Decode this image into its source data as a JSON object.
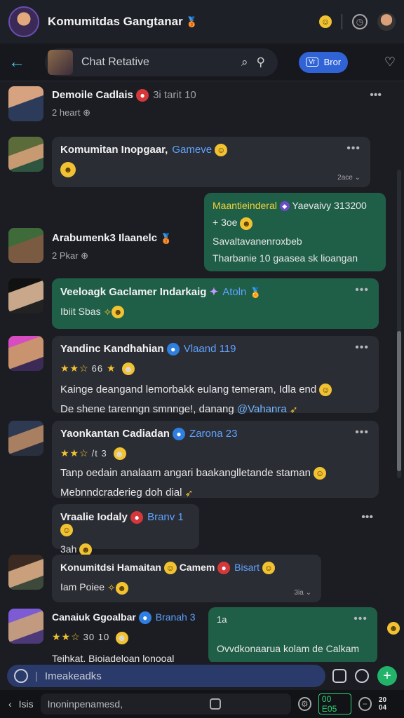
{
  "header": {
    "title": "Komumitdas Gangtanar",
    "title_emoji": "🥉",
    "right_icons": [
      "smiley-icon",
      "clock-icon",
      "profile-avatar"
    ]
  },
  "nav": {
    "search_label": "Chat Retative",
    "bot_icon_text": "Vr",
    "bot_label": "Bror"
  },
  "messages": [
    {
      "name": "Demoile Cadlais",
      "tag": "3i tarit 10",
      "sub": "2 heart ⊕"
    },
    {
      "name": "Komumitan Inopgaar,",
      "tag": "Gameve",
      "time": "2ace"
    },
    {
      "name": "Maantieinderal",
      "tag": "Yaevaivy 313200",
      "line1": "+ 3oe",
      "line2": "Savaltavanenroxbeb",
      "line3": "Tharbanie 10 gaasea sk lioangan"
    },
    {
      "name": "Arabumenk3 Ilaanelc",
      "sub": "2 Pkar ⊕"
    },
    {
      "name": "Veeloagk Gaclamer Indarkaig",
      "tag": "Atoln",
      "line1": "Ibiit Sbas"
    },
    {
      "name": "Yandinc Kandhahian",
      "tag": "Vlaand 119",
      "stars_text": "66",
      "line1": "Kainge deangand lemorbakk eulang temeram, Idla end",
      "line2a": "De shene tarenngn smnnge!, danang",
      "line2b": "@Vahanra"
    },
    {
      "name": "Yaonkantan Cadiadan",
      "tag": "Zarona 23",
      "stars_text": "/t 3",
      "line1": "Tanp oedain analaam angari baakanglletande staman",
      "line2": "Mebnndcraderieg doh dial"
    },
    {
      "name": "Vraalie Iodaly",
      "tag": "Branv 1",
      "line1": "3ah"
    },
    {
      "name": "Konumitdsi Hamaitan",
      "tag1": "Camem",
      "tag2": "Bisart",
      "line1": "Iam Poiee",
      "time": "3ia"
    },
    {
      "name": "Canaiuk Ggoalbar",
      "tag": "Branah 3",
      "stars_text": "30 10",
      "line1": "Teihkat. Bioiadeloan lonooal",
      "reply_time": "1a",
      "reply_text": "Ovvdkonaarua kolam de Calkam"
    }
  ],
  "composer": {
    "placeholder": "Imeakeadks"
  },
  "bottom": {
    "left_label": "Isis",
    "field_text": "Inoninpenamesd,",
    "live_label": "00 E05",
    "right_label": "20 04"
  }
}
